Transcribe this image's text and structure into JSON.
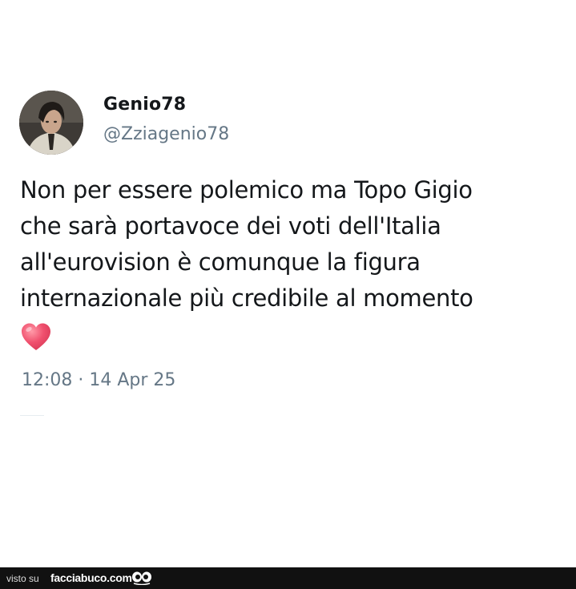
{
  "tweet": {
    "display_name": "Genio78",
    "handle": "@Zziagenio78",
    "text": "Non per essere polemico ma Topo Gigio\nche sarà portavoce dei voti dell'Italia\nall'eurovision è comunque la figura\ninternazionale più credibile al momento",
    "emoji_icon": "heart-icon",
    "timestamp": "12:08 · 14 Apr 25"
  },
  "footer": {
    "visto_su": "visto su",
    "site": "facciabuco.com",
    "logo_icon": "eyes-icon"
  },
  "colors": {
    "text": "#14171a",
    "secondary": "#657786",
    "heart": "#f0506e",
    "footer_bg": "#111111"
  }
}
